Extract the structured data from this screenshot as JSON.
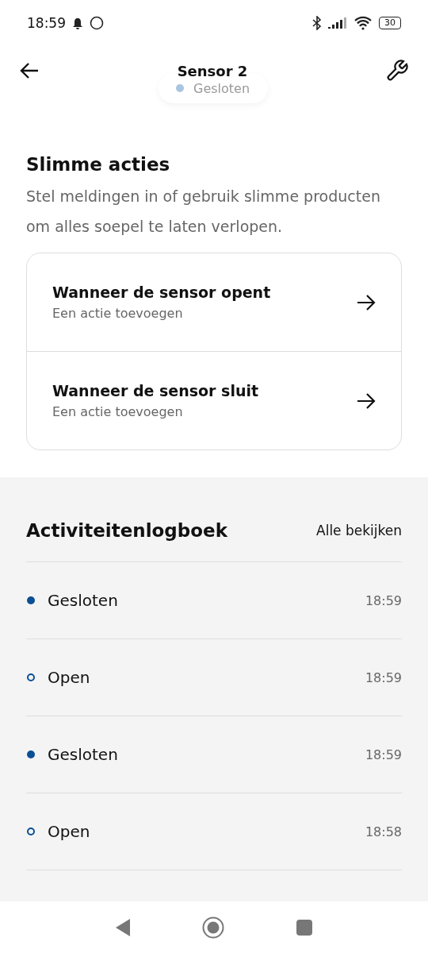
{
  "status_bar": {
    "time": "18:59",
    "battery": "30"
  },
  "header": {
    "title": "Sensor 2",
    "status": {
      "label": "Gesloten"
    }
  },
  "smart_actions": {
    "title": "Slimme acties",
    "description": "Stel meldingen in of gebruik slimme producten om alles soepel te laten verlopen.",
    "items": [
      {
        "title": "Wanneer de sensor opent",
        "subtitle": "Een actie toevoegen"
      },
      {
        "title": "Wanneer de sensor sluit",
        "subtitle": "Een actie toevoegen"
      }
    ]
  },
  "activity_log": {
    "title": "Activiteitenlogboek",
    "link": "Alle bekijken",
    "entries": [
      {
        "kind": "closed",
        "label": "Gesloten",
        "time": "18:59"
      },
      {
        "kind": "open",
        "label": "Open",
        "time": "18:59"
      },
      {
        "kind": "closed",
        "label": "Gesloten",
        "time": "18:59"
      },
      {
        "kind": "open",
        "label": "Open",
        "time": "18:58"
      }
    ]
  }
}
